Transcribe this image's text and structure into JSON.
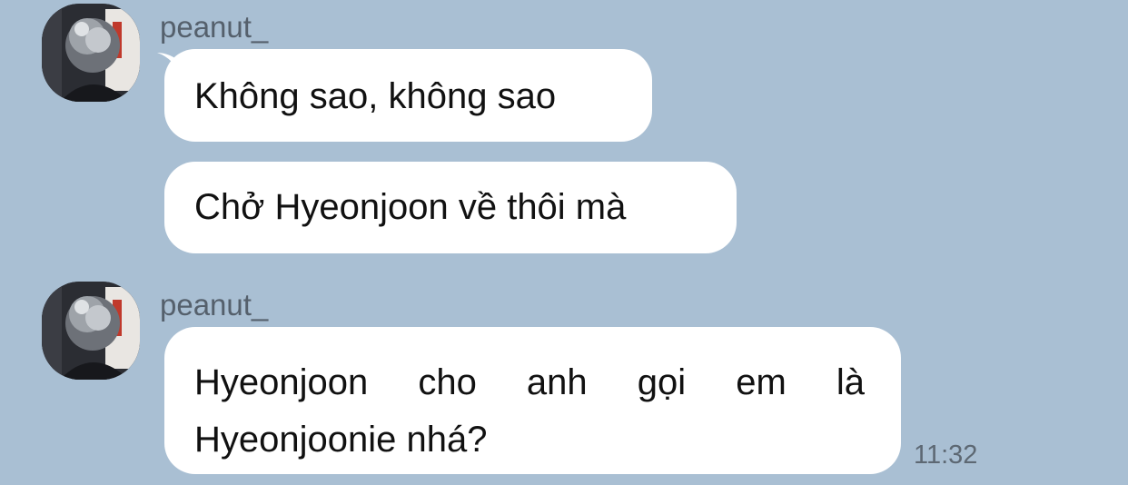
{
  "chat": {
    "messages": [
      {
        "sender": "peanut_",
        "bubbles": [
          {
            "text": "Không sao, không sao"
          },
          {
            "text": "Chở Hyeonjoon về thôi mà"
          }
        ]
      },
      {
        "sender": "peanut_",
        "bubbles": [
          {
            "line1_words": [
              "Hyeonjoon",
              "cho",
              "anh",
              "gọi",
              "em",
              "là"
            ],
            "line2": "Hyeonjoonie nhá?"
          }
        ],
        "time": "11:32"
      }
    ],
    "colors": {
      "background": "#a9bfd3",
      "bubble": "#ffffff",
      "sender_name": "#55606c",
      "timestamp": "#5d6873"
    }
  }
}
